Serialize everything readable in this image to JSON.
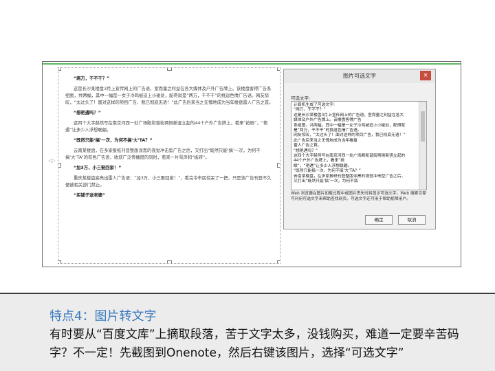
{
  "doc": {
    "h1": "“两万，干不干？”",
    "p1": "这是长沙某楼盘3月上宣传网上的广告语，室而量之利益在各大媒体及户外广告牌上。该楼盘客得广告系组图，共两幅，其中一幅是一女子冷鸣被迫上小碰处，配得就是“两万，干不干”的挑逗色情广告语。网友惊叹，“太过头了！面对这样的项目广告，我已彻底无语！”此广告后来当之无愧地成为当年楼盘雷人广告之首。",
    "h2": "“想艳遇吗？”",
    "p2": "这四个大字赫然写在南京河西一处广场殿和谐街两侧新竖立起的44个户外广告牌上，看来“抢眼”，“艳遇”让多少人浮想联翩。",
    "h3": "“既然只能‘搞’一次，为何不搞‘大’TA？”",
    "p3": "云南某楼盘，在多家报纸刊登整版涂黑的视觉冲击型广告之后，又打出“既然只能‘搞’一次，为何不搞‘大’TA”的有色广告语，收获广泛传播度的同时，惹来一片骂声和“板砖”。",
    "h4": "“加3万，小三娶回家！”",
    "p4": "重庆某楼盘高亮出雷人广告语：“加3万，小三娶回家！”，看完令市民惊呆了一把，只是该广告刊登不久便被相关部门禁止。",
    "h5": "“买铺子送老婆”"
  },
  "dialog": {
    "title": "图片可选文字",
    "close": "×",
    "label": "可选文字:",
    "text": "计算机生成了可选文字:\n“两万，干不干？”\n这是长沙某楼盘3月上宣传网上的广告语，室而量之利益在各大\n媒体及户外广告牌上。该楼盘客得广告\n系组图，共两幅，其中一幅是一女子冷鸣被迫上小碰处，配得就\n是“两万，干不干”的挑逗色情广告语。\n网友惊叹，“太过头了！面对这样的项目广告，我已彻底无语！”\n此广告后来当之无愧地成为当年楼盘\n雷人广告之首。\n“想艳遇吗？”\n这四个大字赫然写在南京河西一处广场殿和谐街两侧新竖立起的\n44个户外广告牌上，看来“抢\n眼”，“艳遇”让多少人浮想联翩。\n“既然只能搞一次，为何不搞‘大’TA？”\n云南某楼盘，在多家报纸刊登整版涂黑的视觉冲击型广告之后，\n又打出“既然只能‘搞’一次，为何不搞",
    "note": "Web 浏览器在图片加载过程中或图片丢失时将显示可选文字。Web 搜索引擎可利用可选文字来帮助查找网页。可选文字还可用于帮助视障用户。",
    "ok": "确定",
    "cancel": "取消"
  },
  "slide": {
    "title": "特点4：图片转文字",
    "body": "有时要从“百度文库”上摘取段落，苦于文字太多，没钱购买，难道一定要辛苦码字？不一定！先截图到Onenote，然后右键该图片，选择“可选文字”"
  }
}
